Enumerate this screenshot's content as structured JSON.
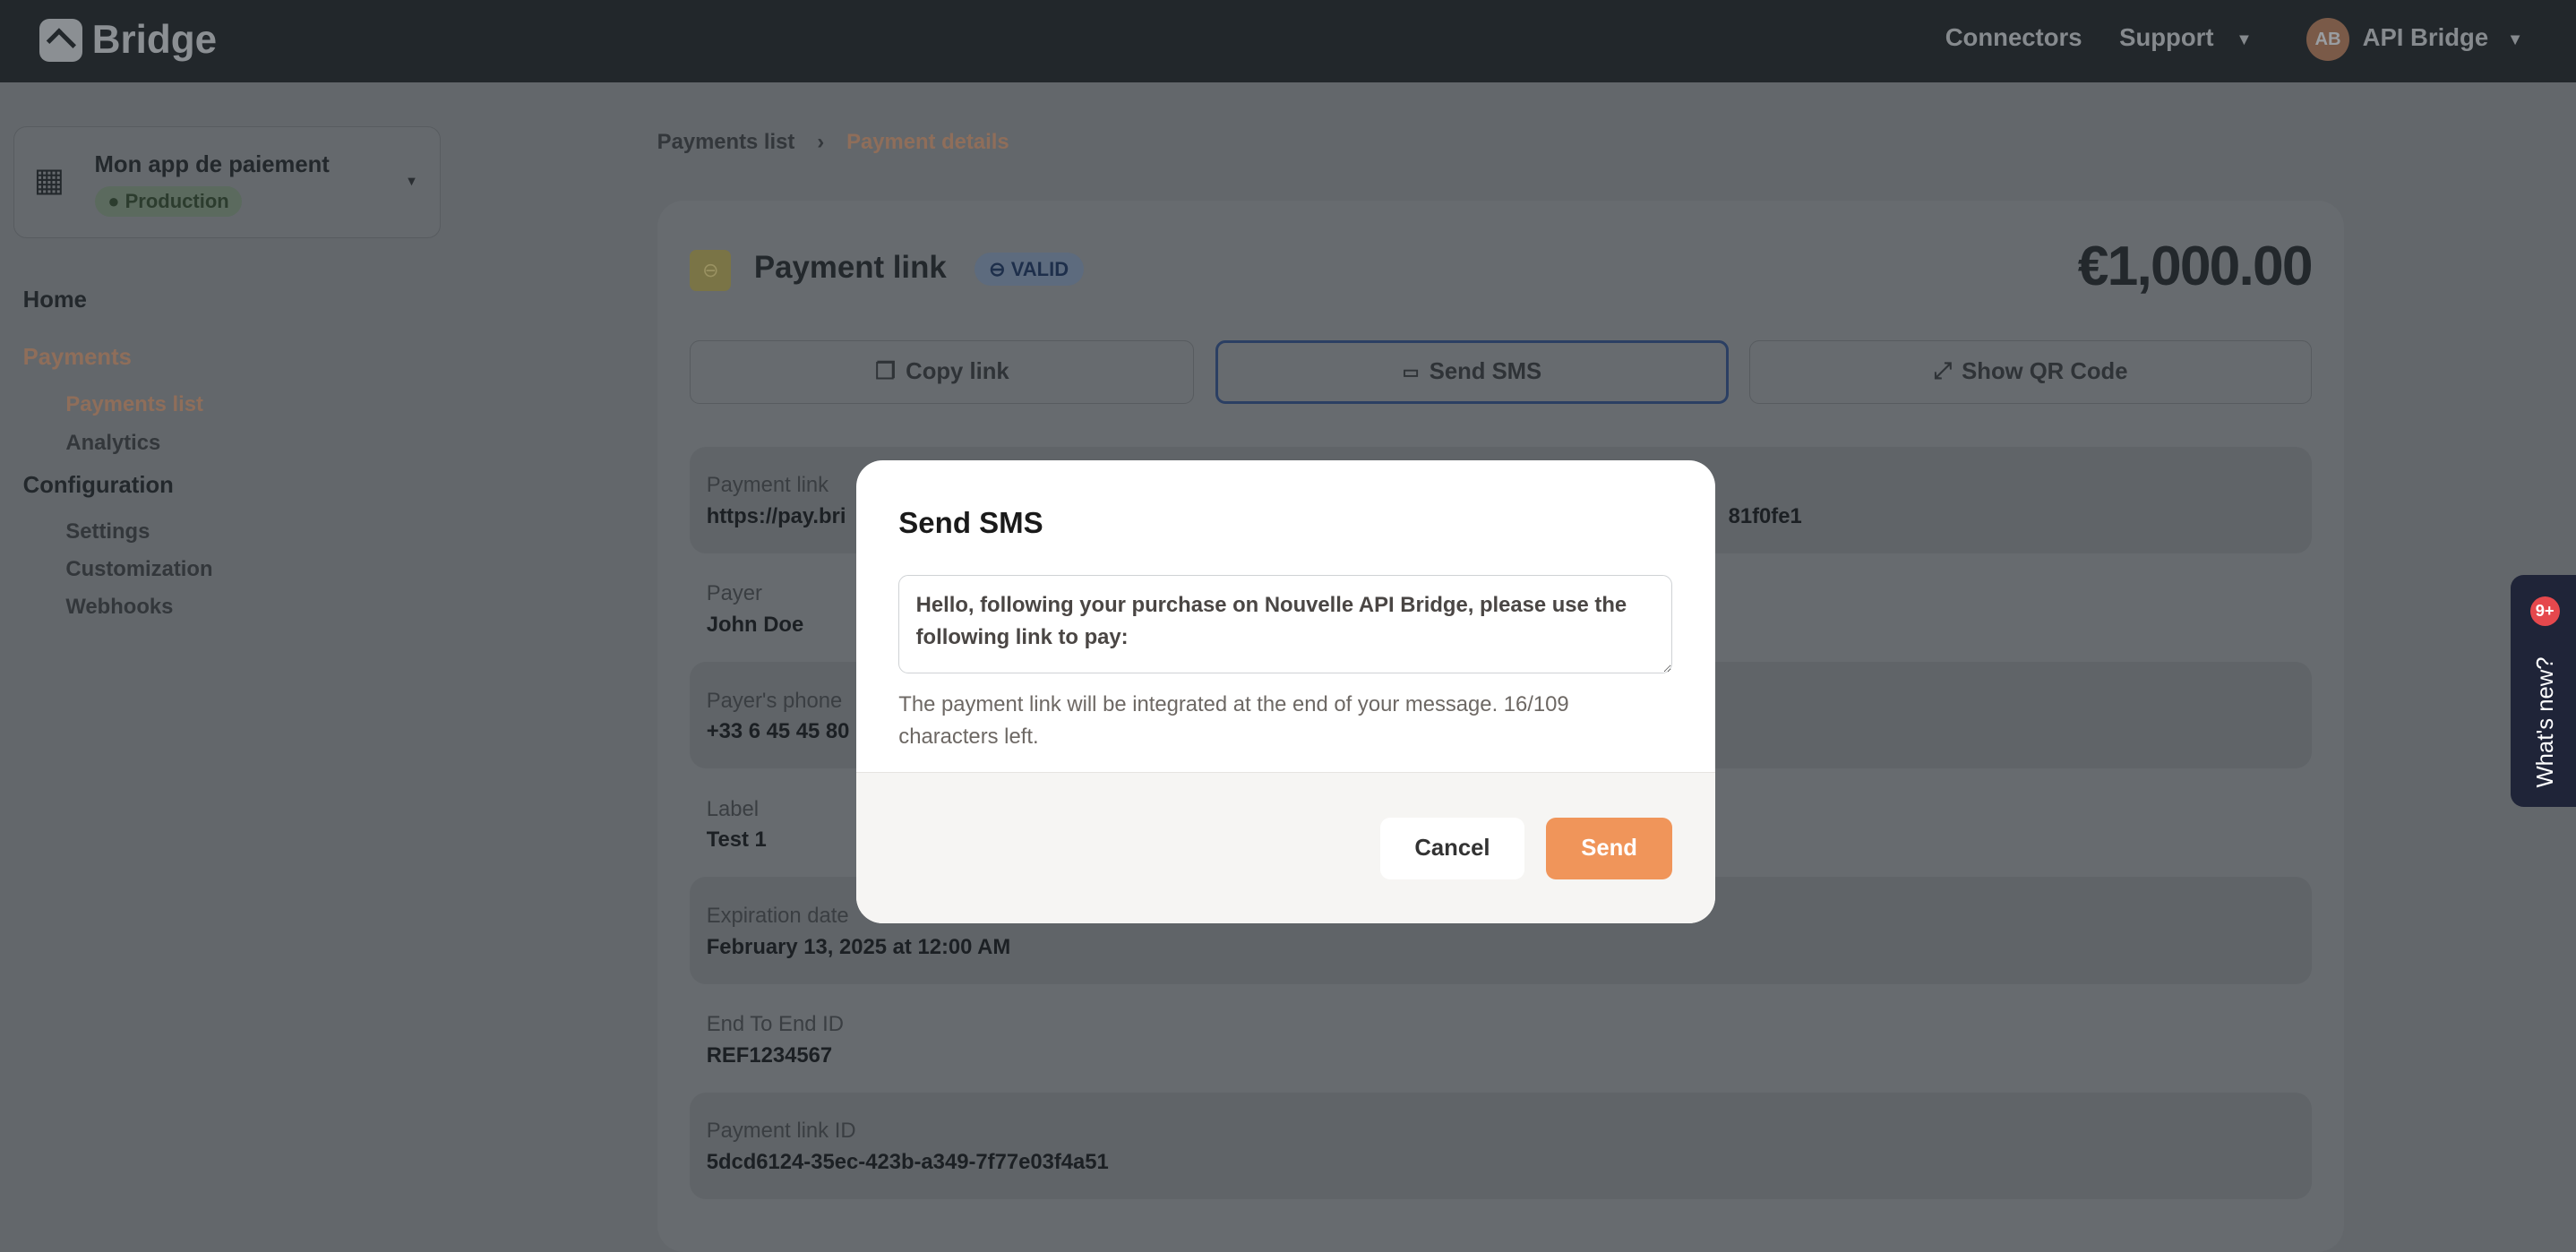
{
  "header": {
    "brand": "Bridge",
    "nav": {
      "connectors": "Connectors",
      "support": "Support"
    },
    "user": {
      "initials": "AB",
      "name": "API Bridge"
    }
  },
  "sidebar": {
    "app_name": "Mon app de paiement",
    "env": "Production",
    "items": [
      {
        "label": "Home"
      },
      {
        "label": "Payments"
      },
      {
        "label": "Payments list"
      },
      {
        "label": "Analytics"
      },
      {
        "label": "Configuration"
      },
      {
        "label": "Settings"
      },
      {
        "label": "Customization"
      },
      {
        "label": "Webhooks"
      }
    ]
  },
  "breadcrumb": {
    "parent": "Payments list",
    "current": "Payment details"
  },
  "payment": {
    "title": "Payment link",
    "status": "VALID",
    "amount": "€1,000.00",
    "actions": {
      "copy": "Copy link",
      "sms": "Send SMS",
      "qr": "Show QR Code"
    },
    "fields": [
      {
        "label": "Payment link",
        "value": "https://pay.bri",
        "value_tail": "81f0fe1"
      },
      {
        "label": "Payer",
        "value": "John Doe"
      },
      {
        "label": "Payer's phone",
        "value": "+33 6 45 45 80"
      },
      {
        "label": "Label",
        "value": "Test 1"
      },
      {
        "label": "Expiration date",
        "value": "February 13, 2025 at 12:00 AM"
      },
      {
        "label": "End To End ID",
        "value": "REF1234567"
      },
      {
        "label": "Payment link ID",
        "value": "5dcd6124-35ec-423b-a349-7f77e03f4a51"
      }
    ]
  },
  "modal": {
    "title": "Send SMS",
    "message": "Hello, following your purchase on Nouvelle API Bridge, please use the following link to pay:",
    "helper": "The payment link will be integrated at the end of your message. 16/109 characters left.",
    "cancel": "Cancel",
    "send": "Send"
  },
  "whats_new": {
    "label": "What's new?",
    "badge": "9+"
  },
  "colors": {
    "accent": "#f0955a",
    "header": "#23282d",
    "badge": "#e5484d"
  }
}
